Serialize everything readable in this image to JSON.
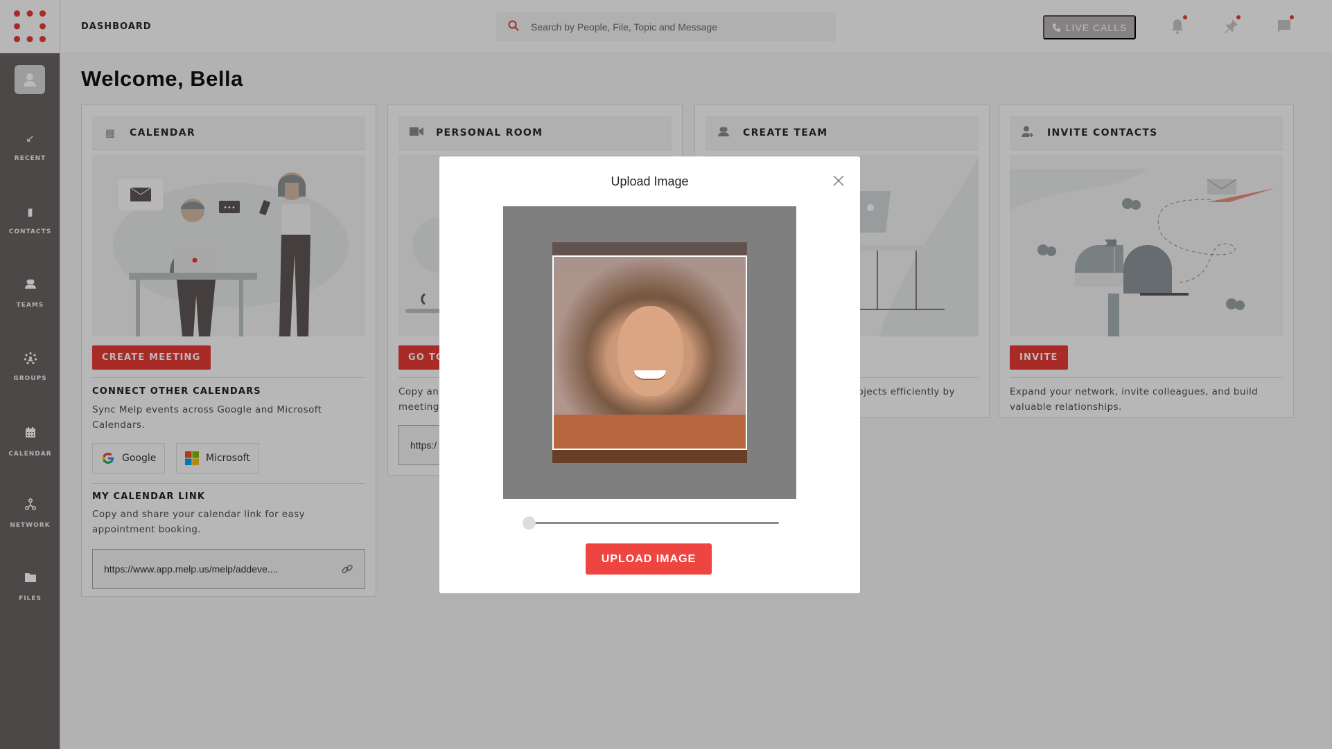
{
  "topbar": {
    "page_label": "DASHBOARD",
    "search_placeholder": "Search by People, File, Topic and Message",
    "live_calls_label": "LIVE CALLS",
    "icons": [
      "bell-icon",
      "pin-icon",
      "chat-icon"
    ]
  },
  "sidebar": {
    "items": [
      {
        "label": "RECENT",
        "icon": "↙"
      },
      {
        "label": "CONTACTS",
        "icon": "▮"
      },
      {
        "label": "TEAMS",
        "icon": "👥"
      },
      {
        "label": "GROUPS",
        "icon": "⁘"
      },
      {
        "label": "CALENDAR",
        "icon": "▦"
      },
      {
        "label": "NETWORK",
        "icon": "⅄"
      },
      {
        "label": "FILES",
        "icon": "▬"
      }
    ]
  },
  "welcome": "Welcome, Bella",
  "cards": {
    "calendar": {
      "title": "CALENDAR",
      "button": "CREATE MEETING",
      "connect_title": "CONNECT OTHER CALENDARS",
      "connect_desc": "Sync Melp events across Google and Microsoft Calendars.",
      "google_label": "Google",
      "microsoft_label": "Microsoft",
      "link_title": "MY CALENDAR LINK",
      "link_desc": "Copy and share your calendar link for easy appointment booking.",
      "link_value": "https://www.app.melp.us/melp/addeve...."
    },
    "personal_room": {
      "title": "PERSONAL ROOM",
      "button": "GO TO",
      "desc": "Copy an meeting",
      "link_value": "https:/"
    },
    "create_team": {
      "title": "CREATE TEAM",
      "desc": "projects efficiently by"
    },
    "invite": {
      "title": "INVITE CONTACTS",
      "button": "INVITE",
      "desc": "Expand your network, invite colleagues, and build valuable relationships."
    }
  },
  "modal": {
    "title": "Upload Image",
    "zoom_slider_value": 0,
    "upload_button": "UPLOAD IMAGE"
  },
  "colors": {
    "accent": "#e63b36",
    "upload_button": "#ef4540",
    "sidebar_bg": "#433d3d"
  }
}
